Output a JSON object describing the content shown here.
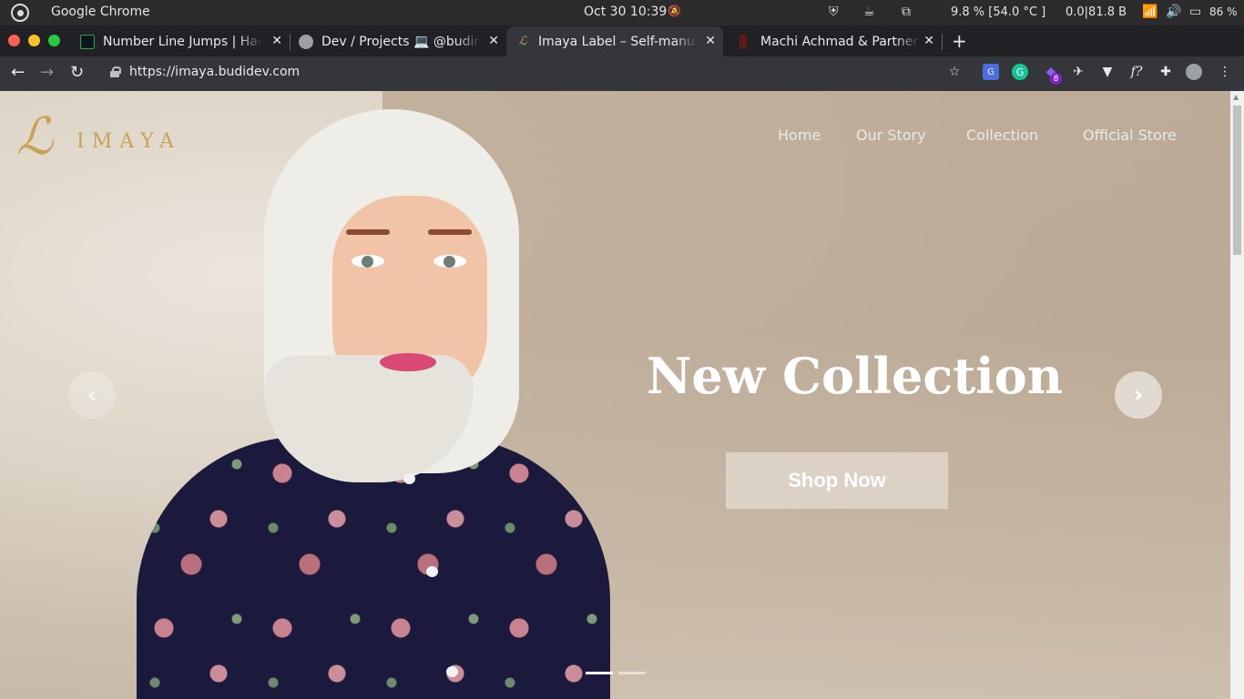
{
  "os": {
    "app_name": "Google Chrome",
    "datetime": "Oct 30  10:39",
    "cpu": "9.8 %  [54.0 °C ]",
    "net": "0.0|81.8 B",
    "battery": "86 %"
  },
  "tabs": [
    {
      "title": "Number Line Jumps | HackerRank",
      "favicon": "hackerrank-icon",
      "active": false
    },
    {
      "title": "Dev / Projects 💻 @budimanlai",
      "favicon": "avatar-icon",
      "active": false
    },
    {
      "title": "Imaya Label – Self-manufactured",
      "favicon": "imaya-icon",
      "active": true
    },
    {
      "title": "Machi Achmad & Partners",
      "favicon": "machi-icon",
      "active": false
    }
  ],
  "toolbar": {
    "url": "https://imaya.budidev.com",
    "ext_badge": "8"
  },
  "site": {
    "logo_glyph": "ℒ",
    "logo_text": "IMAYA",
    "nav": [
      "Home",
      "Our Story",
      "Collection",
      "Official Store"
    ],
    "hero_title": "New Collection",
    "cta_label": "Shop Now",
    "prev_arrow": "‹",
    "next_arrow": "›",
    "slides_total": 2,
    "active_slide": 1
  },
  "colors": {
    "brand_gold": "#c7a35a",
    "chrome_tabbar": "#202124",
    "chrome_toolbar": "#35363a",
    "cta_bg": "rgba(235,228,220,0.62)"
  }
}
